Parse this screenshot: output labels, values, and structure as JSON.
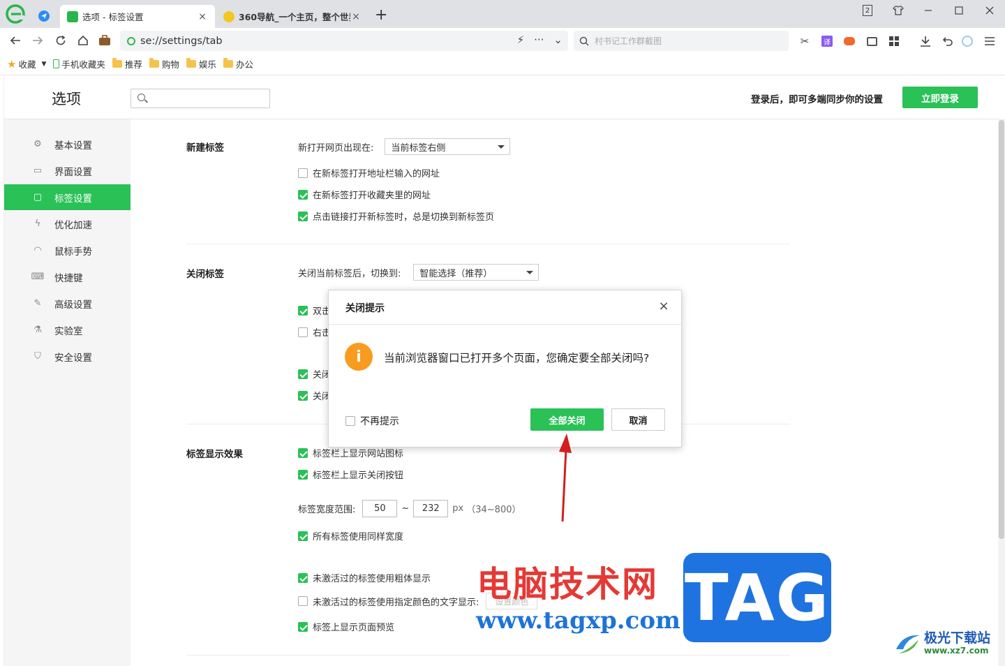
{
  "tabs": [
    {
      "title": "选项 - 标签设置",
      "close": "×"
    },
    {
      "title": "360导航_一个主页，整个世界",
      "close": "×"
    }
  ],
  "window": {
    "tab_count": "2",
    "new_tab": "+"
  },
  "address": {
    "url": "se://settings/tab",
    "search_placeholder": "村书记工作群截图"
  },
  "bookmarks": [
    {
      "label": "收藏"
    },
    {
      "label": "手机收藏夹"
    },
    {
      "label": "推荐"
    },
    {
      "label": "购物"
    },
    {
      "label": "娱乐"
    },
    {
      "label": "办公"
    }
  ],
  "header": {
    "title": "选项",
    "sync_text": "登录后，即可多端同步你的设置",
    "login_button": "立即登录"
  },
  "sidebar": [
    {
      "label": "基本设置",
      "icon": "gear-icon"
    },
    {
      "label": "界面设置",
      "icon": "window-icon"
    },
    {
      "label": "标签设置",
      "icon": "tab-icon",
      "active": true
    },
    {
      "label": "优化加速",
      "icon": "lightning-icon"
    },
    {
      "label": "鼠标手势",
      "icon": "mouse-icon"
    },
    {
      "label": "快捷键",
      "icon": "keyboard-icon"
    },
    {
      "label": "高级设置",
      "icon": "wrench-icon"
    },
    {
      "label": "实验室",
      "icon": "flask-icon"
    },
    {
      "label": "安全设置",
      "icon": "shield-icon"
    }
  ],
  "sections": {
    "new_tab": {
      "title": "新建标签",
      "open_label": "新打开网页出现在:",
      "open_value": "当前标签右侧",
      "options": [
        {
          "label": "在新标签打开地址栏输入的网址",
          "checked": false
        },
        {
          "label": "在新标签打开收藏夹里的网址",
          "checked": true
        },
        {
          "label": "点击链接打开新标签时，总是切换到新标签页",
          "checked": true
        }
      ]
    },
    "close_tab": {
      "title": "关闭标签",
      "switch_label": "关闭当前标签后，切换到:",
      "switch_value": "智能选择（推荐）",
      "options": [
        {
          "label": "双击",
          "checked": true
        },
        {
          "label": "右击",
          "checked": false
        },
        {
          "label": "关闭",
          "checked": true
        },
        {
          "label": "关闭",
          "checked": true
        }
      ]
    },
    "display": {
      "title": "标签显示效果",
      "options": [
        {
          "label": "标签栏上显示网站图标",
          "checked": true
        },
        {
          "label": "标签栏上显示关闭按钮",
          "checked": true
        }
      ],
      "width_label": "标签宽度范围:",
      "width_min": "50",
      "width_sep": "~",
      "width_max": "232",
      "width_unit": "px",
      "width_range": "（34~800）",
      "same_width": "所有标签使用同样宽度",
      "bold": "未激活过的标签使用粗体显示",
      "color_label": "未激活过的标签使用指定颜色的文字显示:",
      "color_button": "设置颜色",
      "preview": "标签上显示页面预览"
    }
  },
  "dialog": {
    "title": "关闭提示",
    "close": "×",
    "icon": "i",
    "message": "当前浏览器窗口已打开多个页面，您确定要全部关闭吗?",
    "dont_remind": "不再提示",
    "confirm": "全部关闭",
    "cancel": "取消"
  },
  "watermark": {
    "cn": "电脑技术网",
    "url": "www.tagxp.com",
    "tag": "TAG",
    "site_name": "极光下载站",
    "site_url": "www.xz7.com"
  },
  "colors": {
    "accent": "#2ac157",
    "warning": "#f99b1f",
    "arrow": "#d21f1f"
  }
}
